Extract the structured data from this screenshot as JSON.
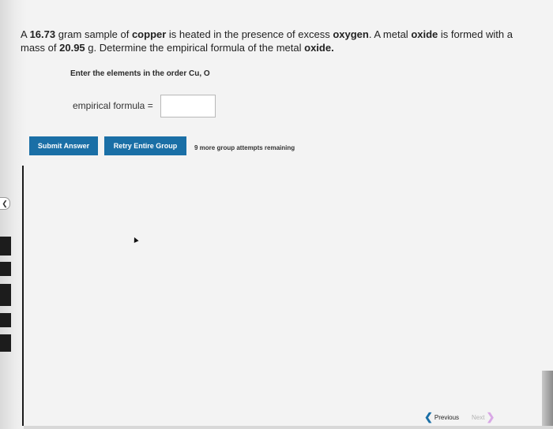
{
  "question": {
    "t1": "A ",
    "mass_copper": "16.73",
    "t2": " gram sample of ",
    "copper": "copper",
    "t3": " is heated in the presence of excess ",
    "oxygen": "oxygen",
    "t4": ". A metal ",
    "oxide": "oxide",
    "t5": " is formed with a mass of ",
    "mass_oxide": "20.95",
    "t6": " g. Determine the empirical formula of the metal ",
    "oxide2": "oxide.",
    "t7": ""
  },
  "instruction": "Enter the elements in the order Cu, O",
  "formula": {
    "label": "empirical formula  =",
    "value": ""
  },
  "buttons": {
    "submit": "Submit Answer",
    "retry": "Retry Entire Group"
  },
  "attempts_text": "9 more group attempts remaining",
  "nav": {
    "previous": "Previous",
    "next": "Next"
  }
}
